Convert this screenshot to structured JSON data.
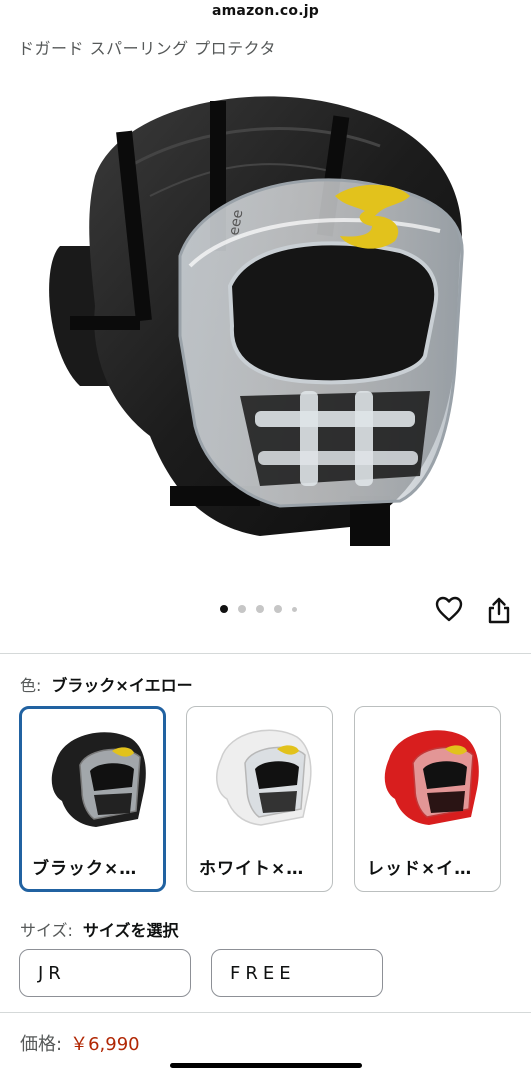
{
  "browser": {
    "domain": "amazon.co.jp"
  },
  "product": {
    "title": "ドガード スパーリング プロテクタ"
  },
  "gallery": {
    "image_count": 5,
    "active_index": 0,
    "visor_logo_text": "eee"
  },
  "actions": {
    "wishlist_icon": "heart-icon",
    "share_icon": "share-icon"
  },
  "color": {
    "label": "色:",
    "selected": "ブラック×イエロー",
    "options": [
      {
        "label": "ブラック×…",
        "shell_color": "#1e1e1e",
        "selected": true
      },
      {
        "label": "ホワイト×…",
        "shell_color": "#eeeeee",
        "selected": false
      },
      {
        "label": "レッド×イ…",
        "shell_color": "#d81e1e",
        "selected": false
      }
    ]
  },
  "size": {
    "label": "サイズ:",
    "selected": "サイズを選択",
    "options": [
      "JR",
      "FREE"
    ]
  },
  "price": {
    "label": "価格:",
    "value": "￥6,990"
  },
  "theme": {
    "selected_border": "#2162a1",
    "price_color": "#b12704",
    "brand_logo_color": "#e2c21c"
  }
}
